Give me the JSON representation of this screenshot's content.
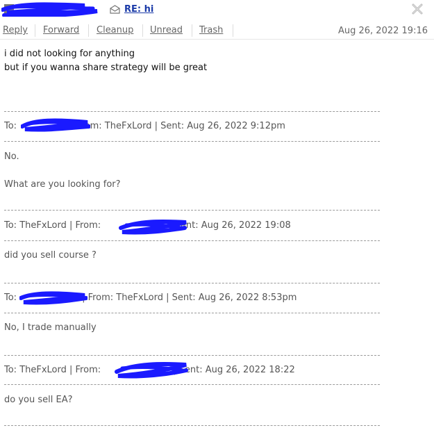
{
  "subject": "RE: hi",
  "toolbar": {
    "reply": "Reply",
    "forward": "Forward",
    "cleanup": "Cleanup",
    "unread": "Unread",
    "trash": "Trash"
  },
  "date": "Aug 26, 2022 19:16",
  "reply_body": {
    "line1": "i did not looking for anything",
    "line2": "but if you wanna share strategy will be great"
  },
  "thread": [
    {
      "header_to": "To:",
      "header_rest": "From: TheFxLord | Sent: Aug 26, 2022 9:12pm",
      "lines": [
        "No.",
        "What are you looking for?"
      ]
    },
    {
      "header_to": "To: TheFxLord | From:",
      "header_rest": "| Sent: Aug 26, 2022 19:08",
      "lines": [
        "did you sell course ?"
      ]
    },
    {
      "header_to": "To:",
      "header_rest": "| From: TheFxLord | Sent: Aug 26, 2022 8:53pm",
      "lines": [
        "No, I trade manually"
      ]
    },
    {
      "header_to": "To: TheFxLord | From:",
      "header_rest": "| Sent: Aug 26, 2022 18:22",
      "lines": [
        "do you sell EA?"
      ]
    }
  ],
  "colors": {
    "redaction": "#1a1aff",
    "subject_link": "#1a3aa8",
    "muted_text": "#666666",
    "quoted_text": "#555555"
  }
}
